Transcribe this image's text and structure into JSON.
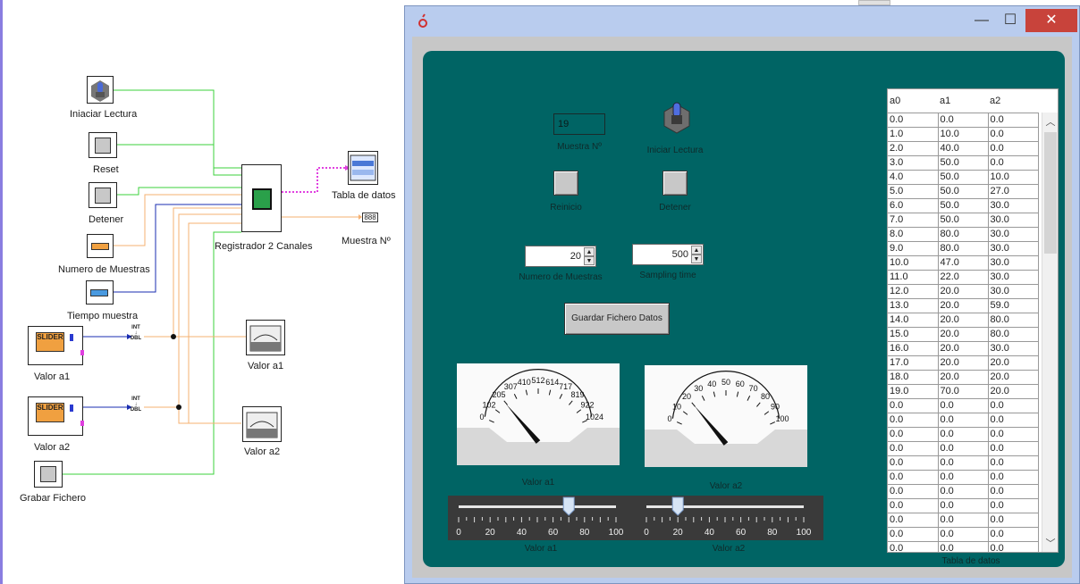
{
  "diagram": {
    "blocks": [
      {
        "label": "Iniaciar Lectura"
      },
      {
        "label": "Reset"
      },
      {
        "label": "Detener"
      },
      {
        "label": "Numero de Muestras"
      },
      {
        "label": "Tiempo muestra"
      },
      {
        "label": "Valor a1",
        "slider_text": "SLIDER"
      },
      {
        "label": "Valor a2",
        "slider_text": "SLIDER"
      },
      {
        "label": "Grabar Fichero"
      },
      {
        "label": "Registrador 2 Canales"
      },
      {
        "label": "Tabla de datos"
      },
      {
        "label": "Muestra Nº",
        "display": "888"
      },
      {
        "label": "Valor a1"
      },
      {
        "label": "Valor a2"
      }
    ],
    "conv_lines": [
      "INT",
      "↓",
      "DBL"
    ]
  },
  "window": {
    "app_icon": "app-logo",
    "controls": {
      "minimize": "—",
      "maximize": "☐",
      "close": "✕"
    }
  },
  "panel": {
    "muestra": {
      "value": "19",
      "label": "Muestra Nº"
    },
    "iniciar": {
      "label": "Iniciar Lectura"
    },
    "reinicio": {
      "label": "Reinicio"
    },
    "detener": {
      "label": "Detener"
    },
    "num_muestras": {
      "value": "20",
      "label": "Numero de Muestras"
    },
    "sampling": {
      "value": "500",
      "label": "Sampling time"
    },
    "guardar": {
      "label": "Guardar Fichero Datos"
    },
    "gauge1": {
      "label": "Valor a1",
      "ticks": [
        "0",
        "102",
        "205",
        "307",
        "410",
        "512",
        "614",
        "717",
        "819",
        "922",
        "1024"
      ],
      "max": 1024,
      "value": 200
    },
    "gauge2": {
      "label": "Valor a2",
      "ticks": [
        "0",
        "10",
        "20",
        "30",
        "40",
        "50",
        "60",
        "70",
        "80",
        "90",
        "100"
      ],
      "max": 100,
      "value": 20
    },
    "slider1": {
      "label": "Valor a1",
      "ticks": [
        "0",
        "20",
        "40",
        "60",
        "80",
        "100"
      ],
      "value": 70
    },
    "slider2": {
      "label": "Valor a2",
      "ticks": [
        "0",
        "20",
        "40",
        "60",
        "80",
        "100"
      ],
      "value": 20
    },
    "table": {
      "label": "Tabla de datos",
      "columns": [
        "a0",
        "a1",
        "a2"
      ],
      "rows": [
        [
          "0.0",
          "0.0",
          "0.0"
        ],
        [
          "1.0",
          "10.0",
          "0.0"
        ],
        [
          "2.0",
          "40.0",
          "0.0"
        ],
        [
          "3.0",
          "50.0",
          "0.0"
        ],
        [
          "4.0",
          "50.0",
          "10.0"
        ],
        [
          "5.0",
          "50.0",
          "27.0"
        ],
        [
          "6.0",
          "50.0",
          "30.0"
        ],
        [
          "7.0",
          "50.0",
          "30.0"
        ],
        [
          "8.0",
          "80.0",
          "30.0"
        ],
        [
          "9.0",
          "80.0",
          "30.0"
        ],
        [
          "10.0",
          "47.0",
          "30.0"
        ],
        [
          "11.0",
          "22.0",
          "30.0"
        ],
        [
          "12.0",
          "20.0",
          "30.0"
        ],
        [
          "13.0",
          "20.0",
          "59.0"
        ],
        [
          "14.0",
          "20.0",
          "80.0"
        ],
        [
          "15.0",
          "20.0",
          "80.0"
        ],
        [
          "16.0",
          "20.0",
          "30.0"
        ],
        [
          "17.0",
          "20.0",
          "20.0"
        ],
        [
          "18.0",
          "20.0",
          "20.0"
        ],
        [
          "19.0",
          "70.0",
          "20.0"
        ],
        [
          "0.0",
          "0.0",
          "0.0"
        ],
        [
          "0.0",
          "0.0",
          "0.0"
        ],
        [
          "0.0",
          "0.0",
          "0.0"
        ],
        [
          "0.0",
          "0.0",
          "0.0"
        ],
        [
          "0.0",
          "0.0",
          "0.0"
        ],
        [
          "0.0",
          "0.0",
          "0.0"
        ],
        [
          "0.0",
          "0.0",
          "0.0"
        ],
        [
          "0.0",
          "0.0",
          "0.0"
        ],
        [
          "0.0",
          "0.0",
          "0.0"
        ],
        [
          "0.0",
          "0.0",
          "0.0"
        ],
        [
          "0.0",
          "0.0",
          "0.0"
        ]
      ]
    }
  },
  "colors": {
    "panel_bg": "#006464",
    "window_frame": "#b9ccee",
    "wire_green": "#3bd23b",
    "wire_orange": "#f5b070",
    "wire_blue": "#1a2db0",
    "wire_magenta": "#e040e0",
    "close_button": "#c8433b"
  }
}
